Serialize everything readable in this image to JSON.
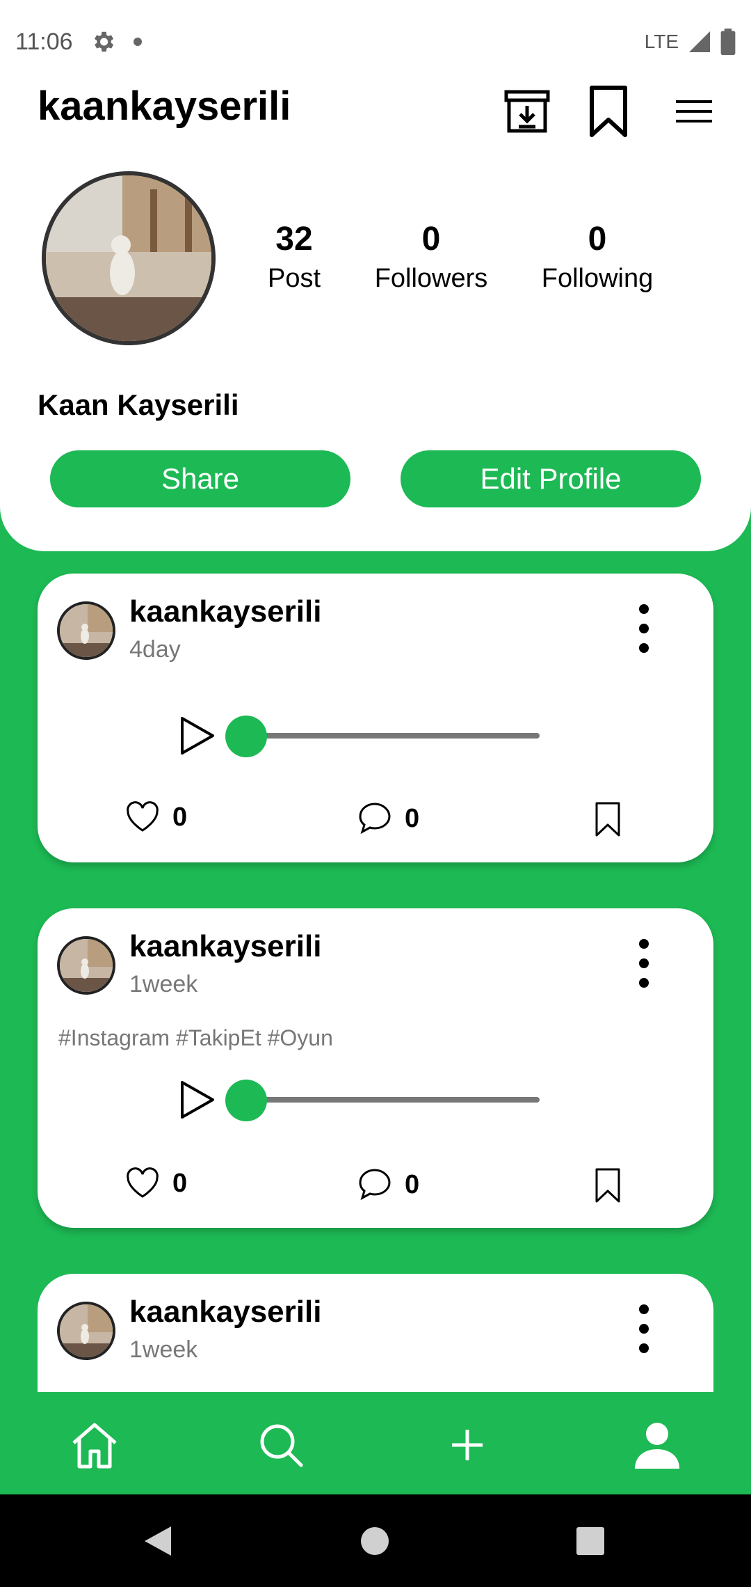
{
  "status_bar": {
    "time": "11:06",
    "network": "LTE"
  },
  "header": {
    "username": "kaankayserili"
  },
  "profile": {
    "stats": [
      {
        "value": "32",
        "label": "Post"
      },
      {
        "value": "0",
        "label": "Followers"
      },
      {
        "value": "0",
        "label": "Following"
      }
    ],
    "full_name": "Kaan Kayserili",
    "share_label": "Share",
    "edit_label": "Edit Profile"
  },
  "posts": [
    {
      "user": "kaankayserili",
      "time": "4day",
      "hashtags": "",
      "likes": "0",
      "comments": "0"
    },
    {
      "user": "kaankayserili",
      "time": "1week",
      "hashtags": "#Instagram #TakipEt #Oyun",
      "likes": "0",
      "comments": "0"
    },
    {
      "user": "kaankayserili",
      "time": "1week",
      "hashtags": "",
      "likes": "",
      "comments": ""
    }
  ],
  "colors": {
    "accent": "#1db954"
  }
}
